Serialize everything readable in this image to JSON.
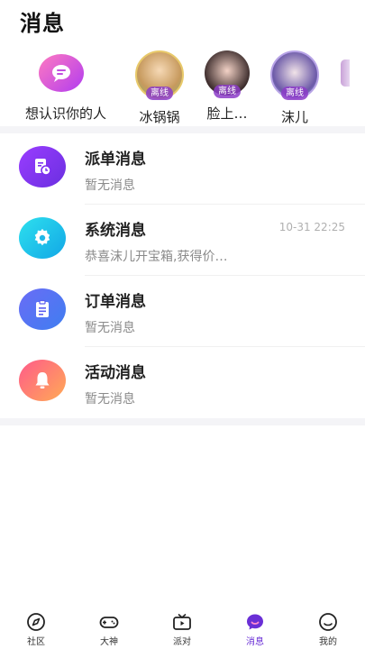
{
  "header": {
    "title": "消息"
  },
  "contacts": [
    {
      "name": "想认识你的人",
      "type": "match-icon"
    },
    {
      "name": "冰锅锅",
      "status": "离线"
    },
    {
      "name": "脸上…",
      "status": "离线"
    },
    {
      "name": "沫儿",
      "status": "离线"
    }
  ],
  "messages": [
    {
      "title": "派单消息",
      "preview": "暂无消息",
      "time": "",
      "icon": "dispatch-icon"
    },
    {
      "title": "系统消息",
      "preview": "恭喜沫儿开宝箱,获得价…",
      "time": "10-31 22:25",
      "icon": "gear-icon"
    },
    {
      "title": "订单消息",
      "preview": "暂无消息",
      "time": "",
      "icon": "clipboard-icon"
    },
    {
      "title": "活动消息",
      "preview": "暂无消息",
      "time": "",
      "icon": "bell-icon"
    }
  ],
  "tabs": [
    {
      "label": "社区",
      "icon": "compass-icon"
    },
    {
      "label": "大神",
      "icon": "gamepad-icon"
    },
    {
      "label": "派对",
      "icon": "tv-icon"
    },
    {
      "label": "消息",
      "icon": "chat-icon",
      "active": true
    },
    {
      "label": "我的",
      "icon": "smile-icon"
    }
  ],
  "colors": {
    "accent": "#6a2fd6",
    "dispatch": "#7b2ff0",
    "system": "#1fc6e8",
    "order": "#5b5cf0",
    "activity": "#ff6b7a"
  }
}
